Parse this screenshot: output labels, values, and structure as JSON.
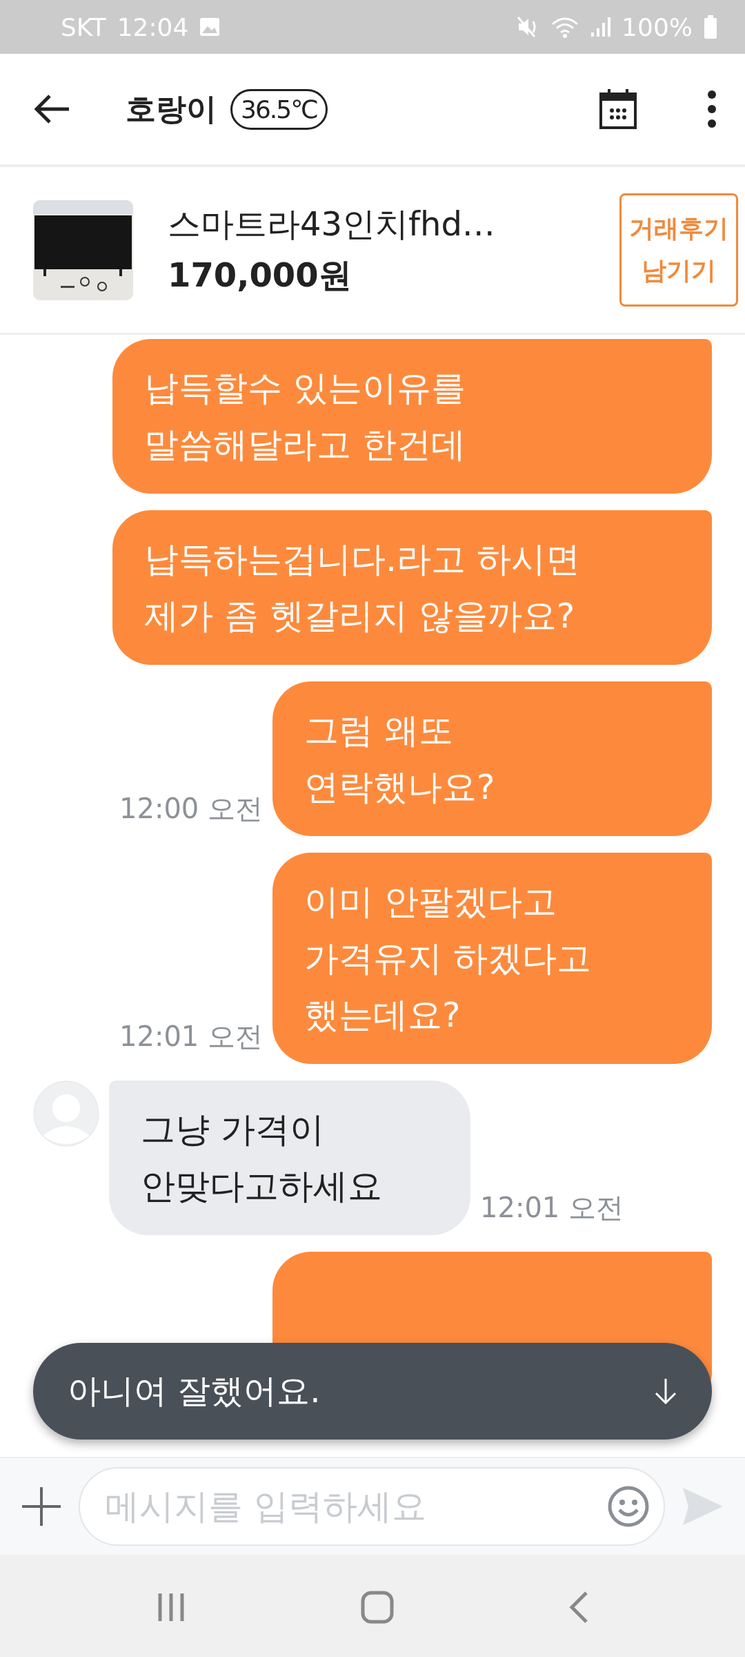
{
  "status_bar": {
    "carrier": "SKT",
    "time": "12:04",
    "battery": "100%"
  },
  "header": {
    "name": "호랑이",
    "temperature": "36.5℃"
  },
  "product": {
    "title": "스마트라43인치fhd…",
    "price": "170,000원",
    "review_button": [
      "거래후기",
      "남기기"
    ]
  },
  "messages": [
    {
      "kind": "mine",
      "lines": [
        "납득할수 있는이유를",
        "말씀해달라고 한건데"
      ]
    },
    {
      "kind": "mine",
      "lines": [
        "납득하는겁니다.라고 하시면",
        "제가 좀 헷갈리지 않을까요?"
      ]
    },
    {
      "kind": "mine",
      "lines": [
        "그럼 왜또",
        "연락했나요?"
      ],
      "time": "12:00 오전"
    },
    {
      "kind": "mine",
      "lines": [
        "이미 안팔겠다고",
        "가격유지 하겠다고",
        "했는데요?"
      ],
      "time": "12:01 오전"
    },
    {
      "kind": "theirs",
      "lines": [
        "그냥 가격이",
        "안맞다고하세요"
      ],
      "time": "12:01 오전"
    },
    {
      "kind": "mine"
    }
  ],
  "toast": {
    "text": "아니여 잘했어요."
  },
  "input": {
    "placeholder": "메시지를 입력하세요"
  }
}
